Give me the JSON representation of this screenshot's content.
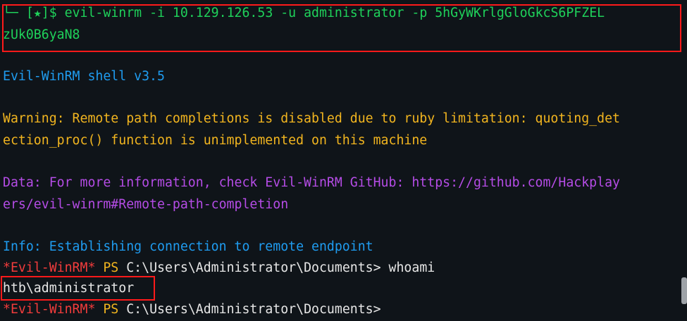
{
  "prompt": {
    "corner": "└─",
    "marker": "[★]",
    "dollar": "$ ",
    "command_line1": "evil-winrm -i 10.129.126.53 -u administrator -p 5hGyWKrlgGloGkcS6PFZEL",
    "command_line2": "zUk0B6yaN8"
  },
  "output": {
    "shell_version": "Evil-WinRM shell v3.5",
    "warning_line1": "Warning: Remote path completions is disabled due to ruby limitation: quoting_det",
    "warning_line2": "ection_proc() function is unimplemented on this machine",
    "data_line1": "Data: For more information, check Evil-WinRM GitHub: https://github.com/Hackplay",
    "data_line2": "ers/evil-winrm#Remote-path-completion",
    "info_line": "Info: Establishing connection to remote endpoint",
    "ps_prompt_name": "*Evil-WinRM*",
    "ps_label": " PS ",
    "ps_path": "C:\\Users\\Administrator\\Documents> ",
    "ps_command1": "whoami",
    "whoami_result": "htb\\administrator"
  },
  "colors": {
    "background": "#0f1419",
    "prompt_green": "#1fd15a",
    "info_blue": "#1f9cf0",
    "warning_yellow": "#f2b51f",
    "data_purple": "#b54ce6",
    "ps_red": "#f23c3c",
    "highlight_box": "#ff1a1a"
  }
}
